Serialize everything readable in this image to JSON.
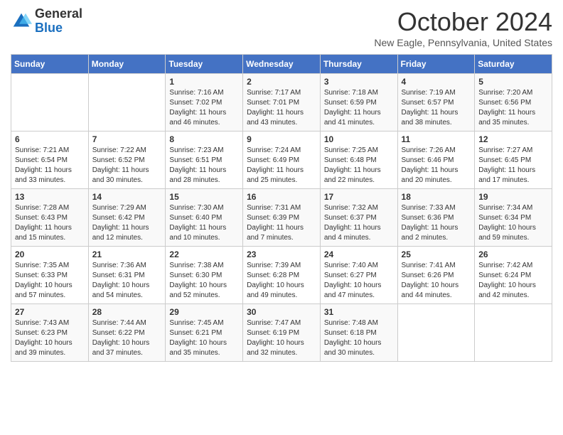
{
  "header": {
    "logo_general": "General",
    "logo_blue": "Blue",
    "month_title": "October 2024",
    "location": "New Eagle, Pennsylvania, United States"
  },
  "days_of_week": [
    "Sunday",
    "Monday",
    "Tuesday",
    "Wednesday",
    "Thursday",
    "Friday",
    "Saturday"
  ],
  "weeks": [
    [
      {
        "day": "",
        "info": ""
      },
      {
        "day": "",
        "info": ""
      },
      {
        "day": "1",
        "info": "Sunrise: 7:16 AM\nSunset: 7:02 PM\nDaylight: 11 hours and 46 minutes."
      },
      {
        "day": "2",
        "info": "Sunrise: 7:17 AM\nSunset: 7:01 PM\nDaylight: 11 hours and 43 minutes."
      },
      {
        "day": "3",
        "info": "Sunrise: 7:18 AM\nSunset: 6:59 PM\nDaylight: 11 hours and 41 minutes."
      },
      {
        "day": "4",
        "info": "Sunrise: 7:19 AM\nSunset: 6:57 PM\nDaylight: 11 hours and 38 minutes."
      },
      {
        "day": "5",
        "info": "Sunrise: 7:20 AM\nSunset: 6:56 PM\nDaylight: 11 hours and 35 minutes."
      }
    ],
    [
      {
        "day": "6",
        "info": "Sunrise: 7:21 AM\nSunset: 6:54 PM\nDaylight: 11 hours and 33 minutes."
      },
      {
        "day": "7",
        "info": "Sunrise: 7:22 AM\nSunset: 6:52 PM\nDaylight: 11 hours and 30 minutes."
      },
      {
        "day": "8",
        "info": "Sunrise: 7:23 AM\nSunset: 6:51 PM\nDaylight: 11 hours and 28 minutes."
      },
      {
        "day": "9",
        "info": "Sunrise: 7:24 AM\nSunset: 6:49 PM\nDaylight: 11 hours and 25 minutes."
      },
      {
        "day": "10",
        "info": "Sunrise: 7:25 AM\nSunset: 6:48 PM\nDaylight: 11 hours and 22 minutes."
      },
      {
        "day": "11",
        "info": "Sunrise: 7:26 AM\nSunset: 6:46 PM\nDaylight: 11 hours and 20 minutes."
      },
      {
        "day": "12",
        "info": "Sunrise: 7:27 AM\nSunset: 6:45 PM\nDaylight: 11 hours and 17 minutes."
      }
    ],
    [
      {
        "day": "13",
        "info": "Sunrise: 7:28 AM\nSunset: 6:43 PM\nDaylight: 11 hours and 15 minutes."
      },
      {
        "day": "14",
        "info": "Sunrise: 7:29 AM\nSunset: 6:42 PM\nDaylight: 11 hours and 12 minutes."
      },
      {
        "day": "15",
        "info": "Sunrise: 7:30 AM\nSunset: 6:40 PM\nDaylight: 11 hours and 10 minutes."
      },
      {
        "day": "16",
        "info": "Sunrise: 7:31 AM\nSunset: 6:39 PM\nDaylight: 11 hours and 7 minutes."
      },
      {
        "day": "17",
        "info": "Sunrise: 7:32 AM\nSunset: 6:37 PM\nDaylight: 11 hours and 4 minutes."
      },
      {
        "day": "18",
        "info": "Sunrise: 7:33 AM\nSunset: 6:36 PM\nDaylight: 11 hours and 2 minutes."
      },
      {
        "day": "19",
        "info": "Sunrise: 7:34 AM\nSunset: 6:34 PM\nDaylight: 10 hours and 59 minutes."
      }
    ],
    [
      {
        "day": "20",
        "info": "Sunrise: 7:35 AM\nSunset: 6:33 PM\nDaylight: 10 hours and 57 minutes."
      },
      {
        "day": "21",
        "info": "Sunrise: 7:36 AM\nSunset: 6:31 PM\nDaylight: 10 hours and 54 minutes."
      },
      {
        "day": "22",
        "info": "Sunrise: 7:38 AM\nSunset: 6:30 PM\nDaylight: 10 hours and 52 minutes."
      },
      {
        "day": "23",
        "info": "Sunrise: 7:39 AM\nSunset: 6:28 PM\nDaylight: 10 hours and 49 minutes."
      },
      {
        "day": "24",
        "info": "Sunrise: 7:40 AM\nSunset: 6:27 PM\nDaylight: 10 hours and 47 minutes."
      },
      {
        "day": "25",
        "info": "Sunrise: 7:41 AM\nSunset: 6:26 PM\nDaylight: 10 hours and 44 minutes."
      },
      {
        "day": "26",
        "info": "Sunrise: 7:42 AM\nSunset: 6:24 PM\nDaylight: 10 hours and 42 minutes."
      }
    ],
    [
      {
        "day": "27",
        "info": "Sunrise: 7:43 AM\nSunset: 6:23 PM\nDaylight: 10 hours and 39 minutes."
      },
      {
        "day": "28",
        "info": "Sunrise: 7:44 AM\nSunset: 6:22 PM\nDaylight: 10 hours and 37 minutes."
      },
      {
        "day": "29",
        "info": "Sunrise: 7:45 AM\nSunset: 6:21 PM\nDaylight: 10 hours and 35 minutes."
      },
      {
        "day": "30",
        "info": "Sunrise: 7:47 AM\nSunset: 6:19 PM\nDaylight: 10 hours and 32 minutes."
      },
      {
        "day": "31",
        "info": "Sunrise: 7:48 AM\nSunset: 6:18 PM\nDaylight: 10 hours and 30 minutes."
      },
      {
        "day": "",
        "info": ""
      },
      {
        "day": "",
        "info": ""
      }
    ]
  ]
}
